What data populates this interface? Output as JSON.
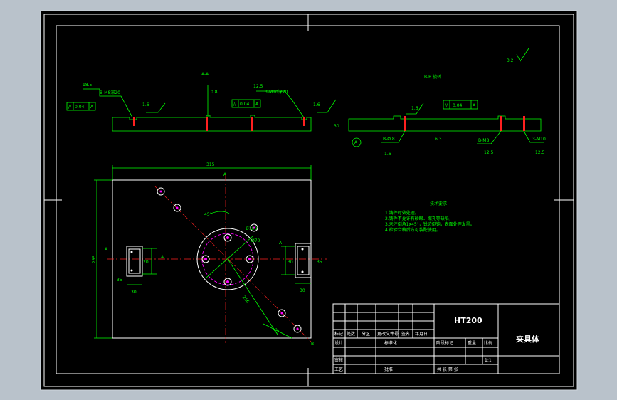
{
  "section_a": {
    "label": "A-A",
    "surface_finish": "0.8",
    "top_width": "12.5",
    "parallelism": [
      "//",
      "0.04",
      "A"
    ]
  },
  "section_b": {
    "label": "B-B 旋转",
    "surface_finish": "1.6",
    "side_dim": "30",
    "parallelism": [
      "//",
      "0.04",
      "A"
    ],
    "hole_callouts": [
      "B-M8",
      "3-M10"
    ],
    "finish_values": [
      "1.6",
      "6.3",
      "12.5"
    ],
    "datum": "A"
  },
  "left_section_dims": {
    "width": "18.5",
    "note": "B-M8深20",
    "finish": "1.6",
    "parallelism": [
      "//",
      "0.04",
      "A"
    ]
  },
  "right_section_dims": {
    "width": "12.5",
    "note": "3-M10深20",
    "finish": "1.6",
    "parallelism": [
      "//",
      "0.04",
      "A"
    ]
  },
  "roughness_mark": "3.2",
  "plan_view": {
    "overall_width": "315",
    "overall_height": "285",
    "angle": "45°",
    "bolt_circle": "Ø100",
    "pcd_hole": "Ø70",
    "diag_dim": "216",
    "diag_dim2": "32",
    "left_block": [
      "A",
      "35",
      "20",
      "30",
      "35"
    ],
    "right_block": [
      "A",
      "30",
      "35",
      "30"
    ],
    "section_marks": [
      "A",
      "A",
      "B",
      "B"
    ]
  },
  "technical_requirements": {
    "title": "技术要求",
    "items": [
      "1.铸件时效处理。",
      "2.铸件不允许有砂眼、缩孔等缺陷，",
      "3.未注倒角1x45°，锐边倒钝，表面处理发黑。",
      "4.检验合格后方可装配使用。"
    ]
  },
  "title_block": {
    "material": "HT200",
    "part_name": "夹具体",
    "scale": "1:1",
    "header_row": [
      "标记",
      "处数",
      "分区",
      "更改文件号",
      "签名",
      "年月日"
    ],
    "rows": [
      "设计",
      "标准化",
      "审核",
      "工艺",
      "批准"
    ],
    "labels": [
      "阶段标记",
      "重量",
      "比例",
      "共 张 第 张"
    ]
  }
}
